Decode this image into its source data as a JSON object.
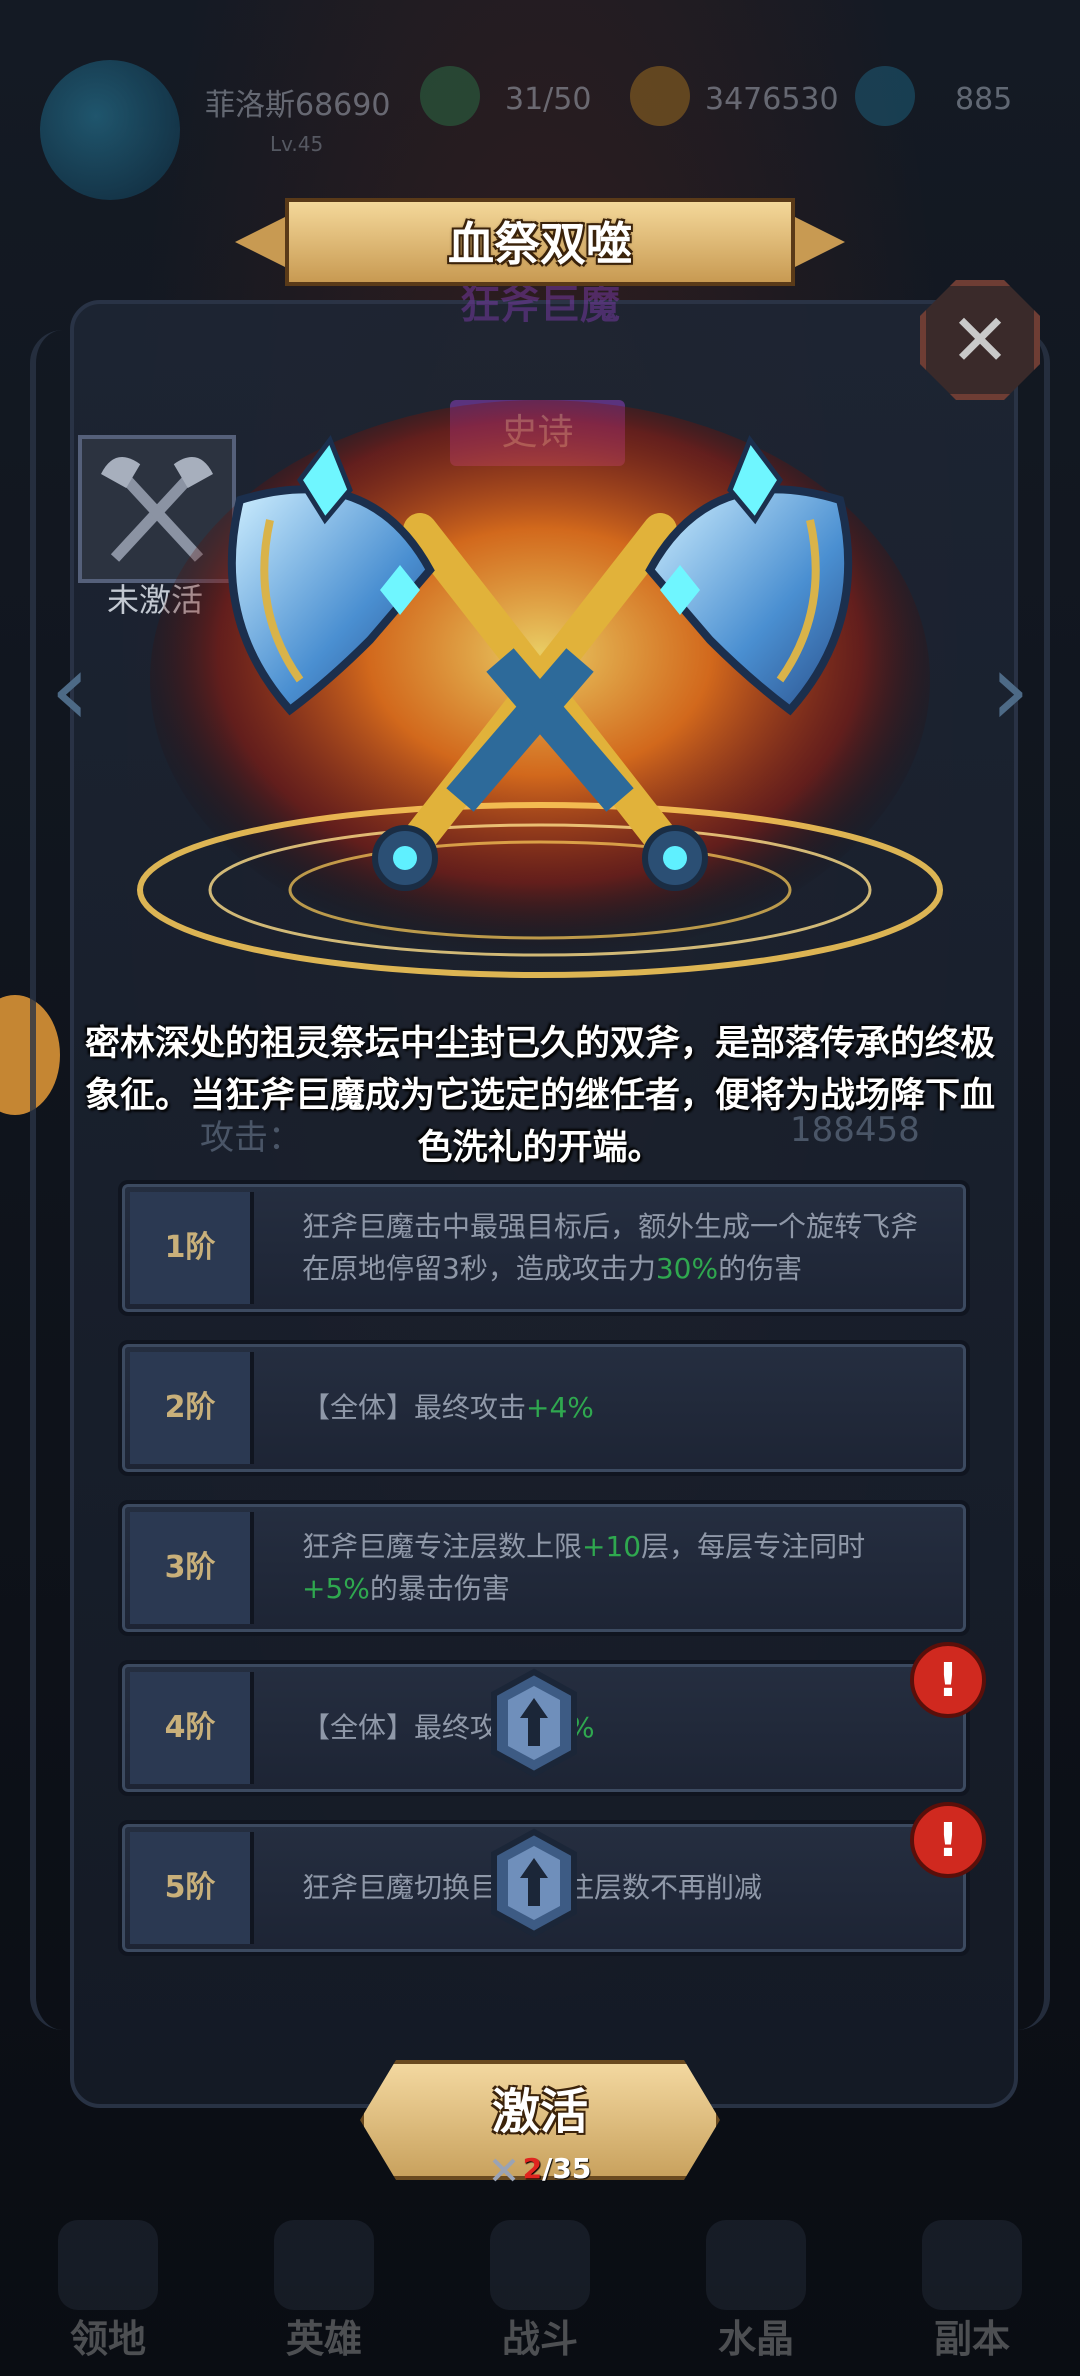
{
  "top_bar": {
    "player_name": "菲洛斯68690",
    "player_level": "Lv.45",
    "stamina": "31/50",
    "gold": "3476530",
    "gems": "885"
  },
  "dialog": {
    "title": "血祭双噬",
    "subtitle_ghost": "狂斧巨魔",
    "rarity": "史诗",
    "status": "未激活",
    "description": "密林深处的祖灵祭坛中尘封已久的双斧，是部落传承的终极象征。当狂斧巨魔成为它选定的继任者，便将为战场降下血色洗礼的开端。",
    "ghost_attack_label": "攻击：",
    "ghost_power": "188458"
  },
  "tiers": [
    {
      "level": "1阶",
      "text_before": "狂斧巨魔击中最强目标后，额外生成一个旋转飞斧在原地停留3秒，造成攻击力",
      "value": "30%",
      "text_after": "的伤害",
      "locked": false,
      "alert": false
    },
    {
      "level": "2阶",
      "text_before": "【全体】最终攻击",
      "value": "+4%",
      "text_after": "",
      "locked": false,
      "alert": false
    },
    {
      "level": "3阶",
      "text_before": "狂斧巨魔专注层数上限",
      "value": "+10",
      "text_after": "层，每层专注同时",
      "value2": "+5%",
      "text_after2": "的暴击伤害",
      "locked": false,
      "alert": false
    },
    {
      "level": "4阶",
      "text_before": "【全体】最终攻",
      "value": "%",
      "text_after": "",
      "locked": true,
      "alert": true
    },
    {
      "level": "5阶",
      "text_before": "狂斧巨魔切换目",
      "value": "",
      "text_after": "专注层数不再削减",
      "locked": true,
      "alert": true
    }
  ],
  "activate": {
    "label": "激活",
    "cost_have": "2",
    "cost_total": "/35"
  },
  "bottom_nav": [
    "领地",
    "英雄",
    "战斗",
    "水晶",
    "副本"
  ],
  "colors": {
    "accent_gold": "#c89a52",
    "highlight_green": "#2fa84f",
    "alert_red": "#d0291f",
    "rarity_purple": "#7a3ba8"
  }
}
